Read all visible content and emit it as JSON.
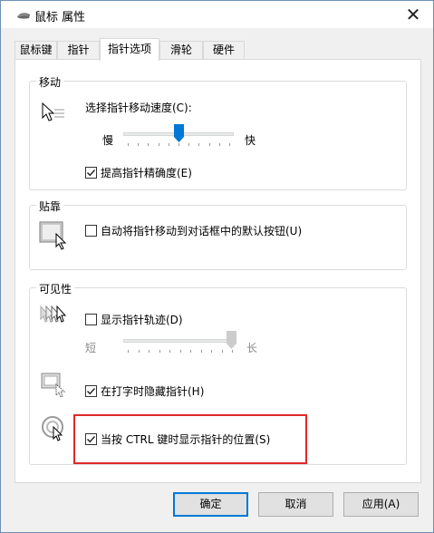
{
  "window": {
    "title": "鼠标 属性",
    "close": "✕"
  },
  "tabs": [
    "鼠标键",
    "指针",
    "指针选项",
    "滑轮",
    "硬件"
  ],
  "motion": {
    "group_title": "移动",
    "speed_label": "选择指针移动速度(C):",
    "slow_label": "慢",
    "fast_label": "快",
    "speed_value_fraction": 0.5,
    "precision_label": "提高指针精确度(E)",
    "precision_checked": true
  },
  "snap": {
    "group_title": "贴靠",
    "snap_label": "自动将指针移动到对话框中的默认按钮(U)",
    "snap_checked": false
  },
  "visibility": {
    "group_title": "可见性",
    "trails_label": "显示指针轨迹(D)",
    "trails_checked": false,
    "short_label": "短",
    "long_label": "长",
    "trails_value_fraction": 1.0,
    "hide_label": "在打字时隐藏指针(H)",
    "hide_checked": true,
    "ctrl_label": "当按 CTRL 键时显示指针的位置(S)",
    "ctrl_checked": true
  },
  "buttons": {
    "ok": "确定",
    "cancel": "取消",
    "apply": "应用(A)"
  }
}
